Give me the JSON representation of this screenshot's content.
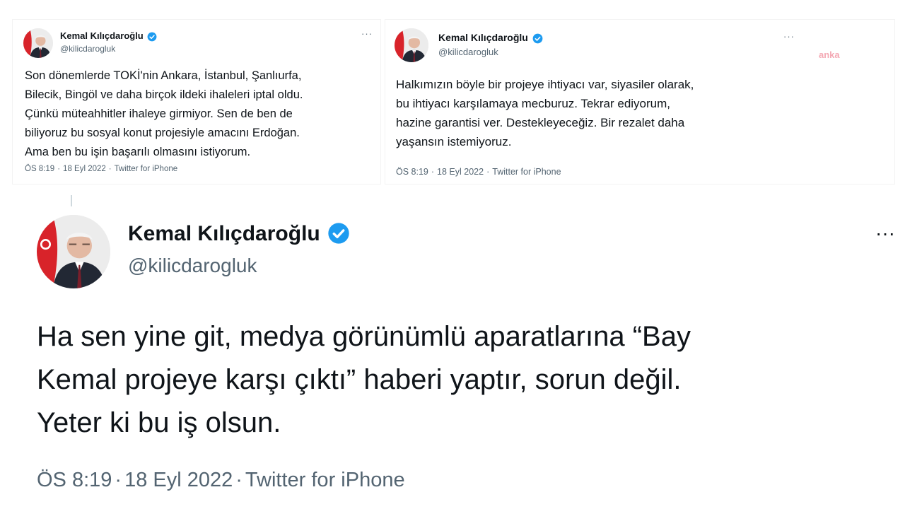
{
  "colors": {
    "verified": "#1d9bf0",
    "text": "#0f1419",
    "secondary": "#536471",
    "flag_red": "#d8232a"
  },
  "tweets": [
    {
      "author_name": "Kemal Kılıçdaroğlu",
      "author_handle": "@kilicdarogluk",
      "more_label": "···",
      "text": "Son dönemlerde TOKİ'nin Ankara, İstanbul, Şanlıurfa,\nBilecik, Bingöl ve daha birçok ildeki ihaleleri iptal oldu.\nÇünkü müteahhitler ihaleye girmiyor. Sen de ben de\nbiliyoruz bu sosyal konut projesiyle amacını Erdoğan.\nAma ben bu işin başarılı olmasını istiyorum.",
      "time": "ÖS 8:19",
      "date": "18 Eyl 2022",
      "source": "Twitter for iPhone"
    },
    {
      "author_name": "Kemal Kılıçdaroğlu",
      "author_handle": "@kilicdarogluk",
      "more_label": "···",
      "text": "Halkımızın böyle bir projeye ihtiyacı var, siyasiler olarak,\nbu ihtiyacı karşılamaya mecburuz. Tekrar ediyorum,\nhazine garantisi ver. Destekleyeceğiz. Bir rezalet daha\nyaşansın istemiyoruz.",
      "time": "ÖS 8:19",
      "date": "18 Eyl 2022",
      "source": "Twitter for iPhone"
    },
    {
      "author_name": "Kemal Kılıçdaroğlu",
      "author_handle": "@kilicdarogluk",
      "more_label": "···",
      "text": "Ha sen yine git, medya görünümlü aparatlarına “Bay\nKemal projeye karşı çıktı” haberi yaptır, sorun değil.\nYeter ki bu iş olsun.",
      "time": "ÖS 8:19",
      "date": "18 Eyl 2022",
      "source": "Twitter for iPhone"
    }
  ],
  "watermark": "anka"
}
